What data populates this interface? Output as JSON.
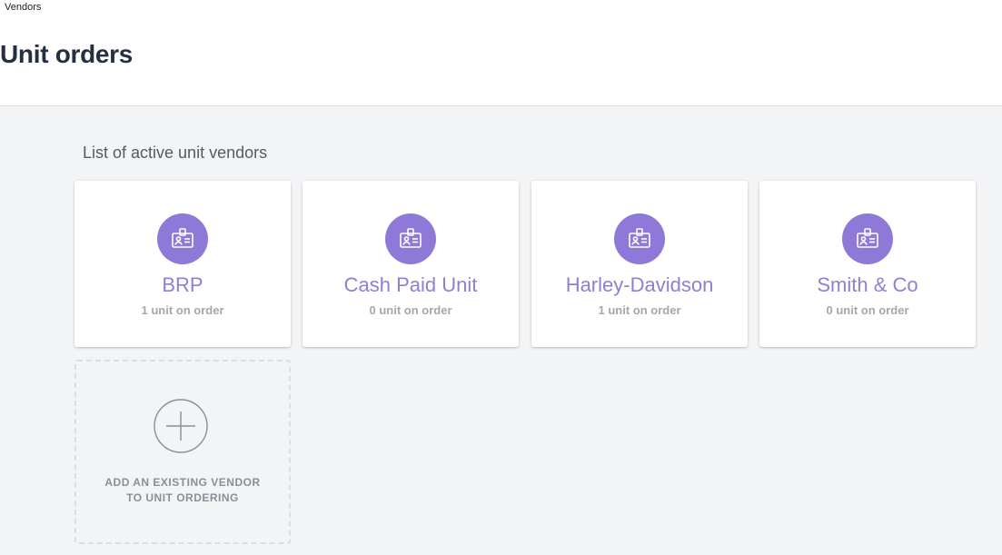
{
  "header": {
    "breadcrumb": "Vendors",
    "title": "Unit orders"
  },
  "main": {
    "section_title": "List of active unit vendors",
    "vendors": [
      {
        "name": "BRP",
        "count": "1 unit on order",
        "icon": "id-badge-icon"
      },
      {
        "name": "Cash Paid Unit",
        "count": "0 unit on order",
        "icon": "id-badge-icon"
      },
      {
        "name": "Harley-Davidson",
        "count": "1 unit on order",
        "icon": "id-badge-icon"
      },
      {
        "name": "Smith & Co",
        "count": "0 unit on order",
        "icon": "id-badge-icon"
      }
    ],
    "add_vendor": {
      "label": "ADD AN EXISTING VENDOR TO UNIT ORDERING",
      "icon": "plus-circle-icon"
    }
  },
  "colors": {
    "accent": "#8f79d8",
    "vendor_name": "#8f7fd4",
    "background": "#f3f4f6"
  }
}
